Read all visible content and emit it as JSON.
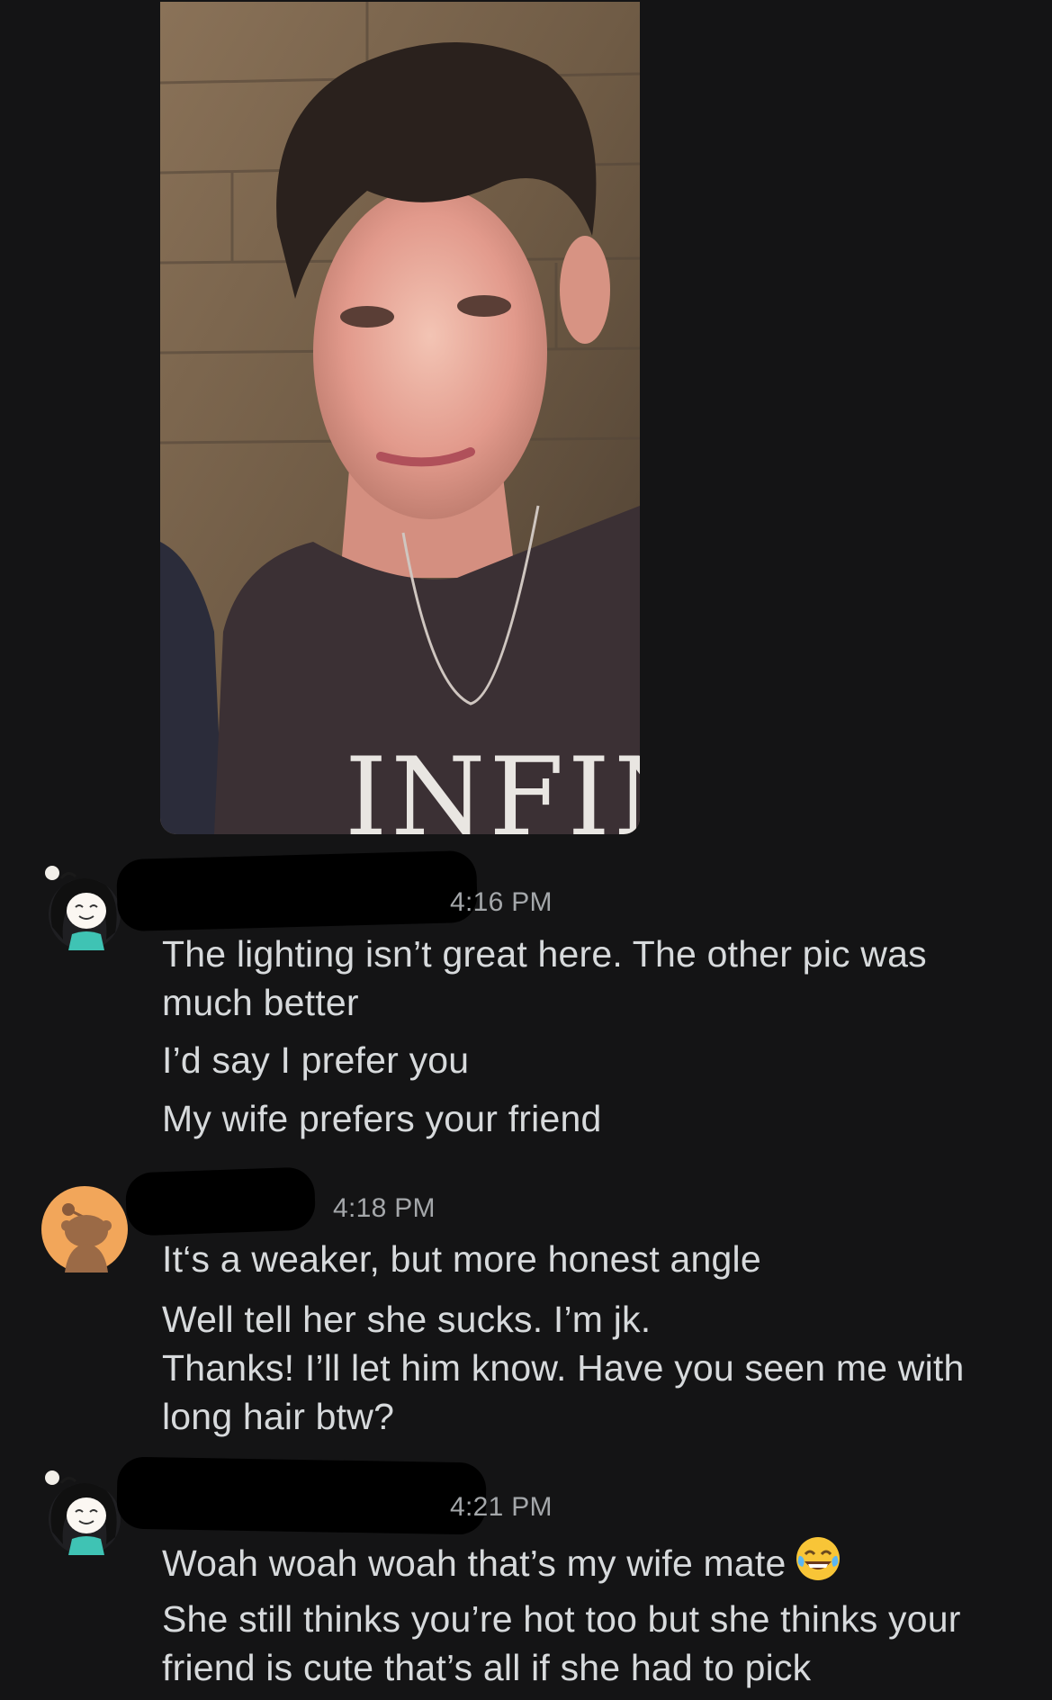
{
  "photo": {
    "shirt_text": "INFINIT"
  },
  "messages": [
    {
      "user": "redacted",
      "time": "4:16 PM",
      "lines": [
        "The lighting isn’t great here. The other pic was much better",
        "I’d say I prefer you",
        "My wife prefers your friend"
      ]
    },
    {
      "user": "redacted",
      "time": "4:18 PM",
      "lines": [
        "It‘s a weaker, but more honest angle",
        "Well tell her she sucks. I’m jk.",
        "Thanks! I’ll let him know. Have you seen me with long hair btw?"
      ]
    },
    {
      "user": "redacted",
      "time": "4:21 PM",
      "lines": [
        "Woah woah woah that’s my wife mate",
        "She still thinks you’re hot too but she thinks your friend is cute that’s all if she had to pick"
      ],
      "emoji": "face-with-tears-of-joy-icon"
    }
  ],
  "colors": {
    "background": "#141415",
    "text": "#d7dadc",
    "timestamp": "#a4a7aa",
    "avatar_orange": "#f2a65a"
  }
}
